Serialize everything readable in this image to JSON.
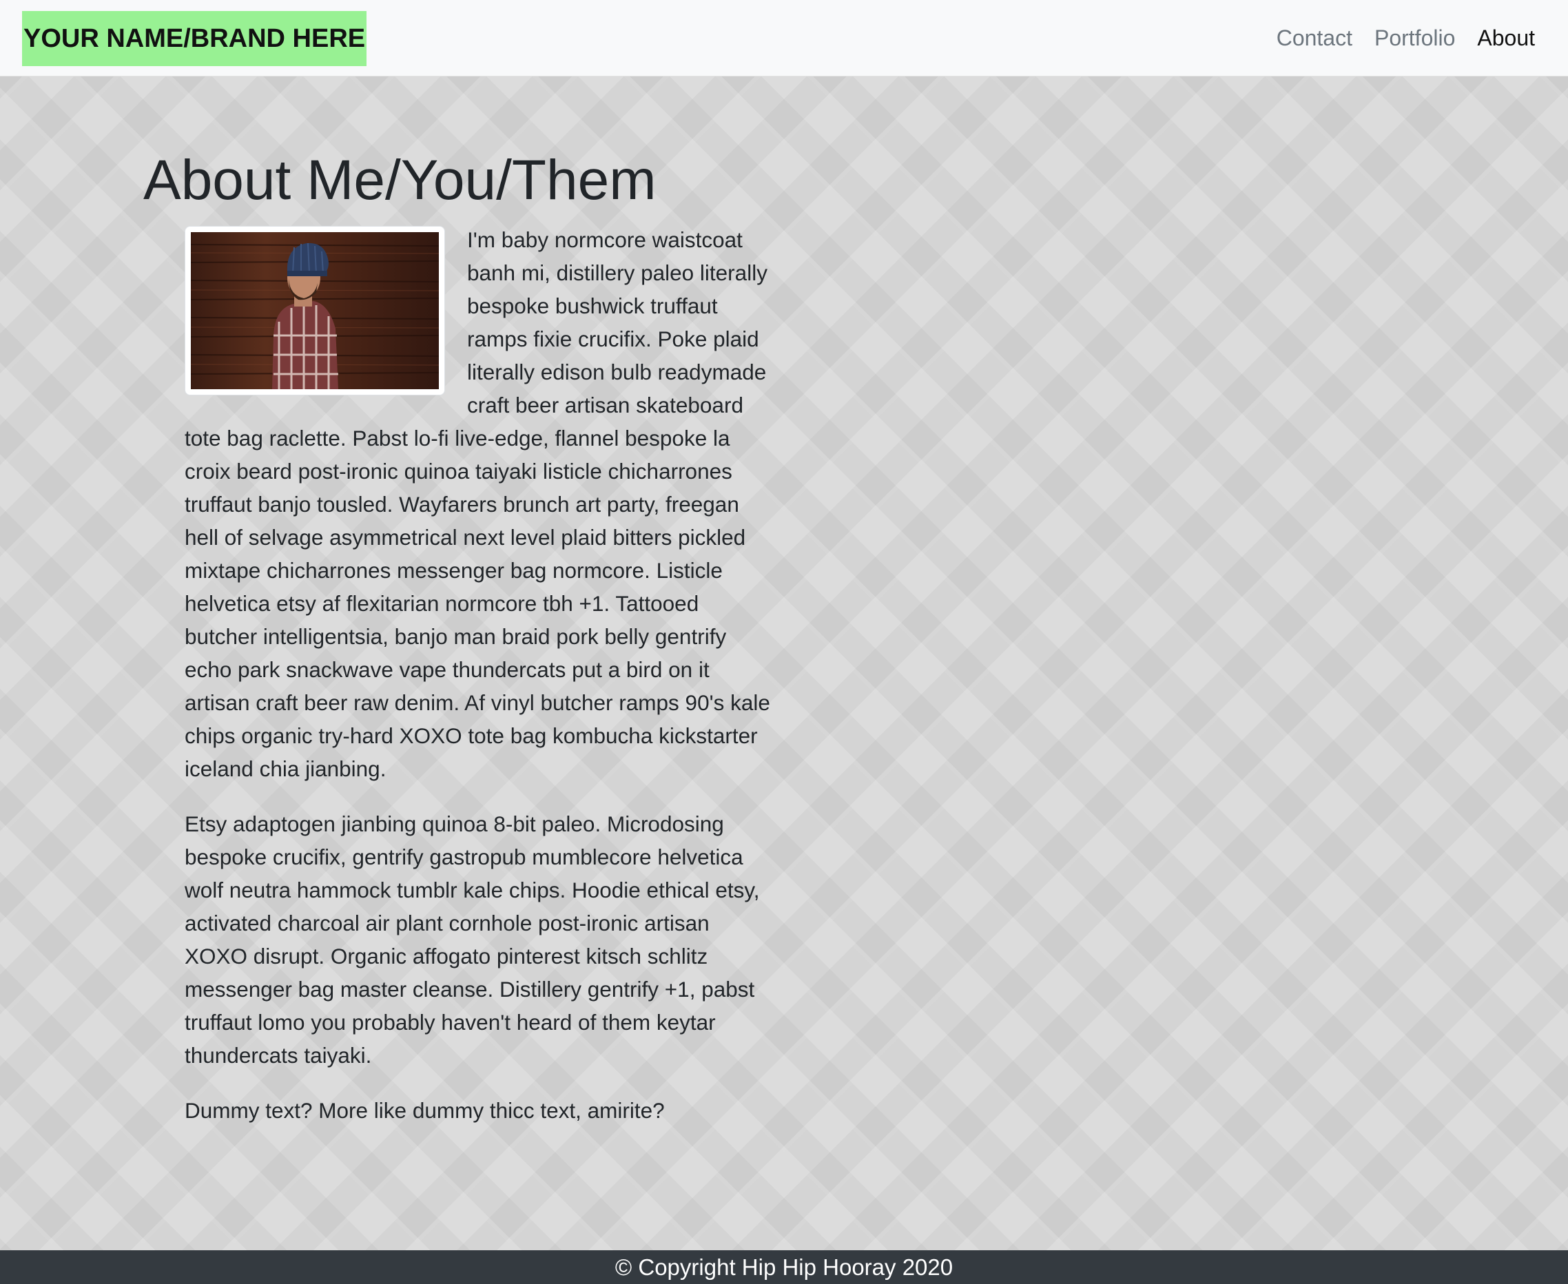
{
  "navbar": {
    "brand": "YOUR NAME/BRAND HERE",
    "links": [
      {
        "label": "Contact"
      },
      {
        "label": "Portfolio"
      },
      {
        "label": "About"
      }
    ],
    "active": "About",
    "brand_bg": "#98f193"
  },
  "main": {
    "heading": "About Me/You/Them",
    "photo_icon": "profile-photo",
    "paragraphs": [
      "I'm baby normcore waistcoat banh mi, distillery paleo literally bespoke bushwick truffaut ramps fixie crucifix. Poke plaid literally edison bulb readymade craft beer artisan skateboard tote bag raclette. Pabst lo-fi live-edge, flannel bespoke la croix beard post-ironic quinoa taiyaki listicle chicharrones truffaut banjo tousled. Wayfarers brunch art party, freegan hell of selvage asymmetrical next level plaid bitters pickled mixtape chicharrones messenger bag normcore. Listicle helvetica etsy af flexitarian normcore tbh +1. Tattooed butcher intelligentsia, banjo man braid pork belly gentrify echo park snackwave vape thundercats put a bird on it artisan craft beer raw denim. Af vinyl butcher ramps 90's kale chips organic try-hard XOXO tote bag kombucha kickstarter iceland chia jianbing.",
      "Etsy adaptogen jianbing quinoa 8-bit paleo. Microdosing bespoke crucifix, gentrify gastropub mumblecore helvetica wolf neutra hammock tumblr kale chips. Hoodie ethical etsy, activated charcoal air plant cornhole post-ironic artisan XOXO disrupt. Organic affogato pinterest kitsch schlitz messenger bag master cleanse. Distillery gentrify +1, pabst truffaut lomo you probably haven't heard of them keytar thundercats taiyaki.",
      "Dummy text? More like dummy thicc text, amirite?"
    ]
  },
  "footer": {
    "copyright": "© Copyright Hip Hip Hooray 2020",
    "bg": "#343a40"
  }
}
